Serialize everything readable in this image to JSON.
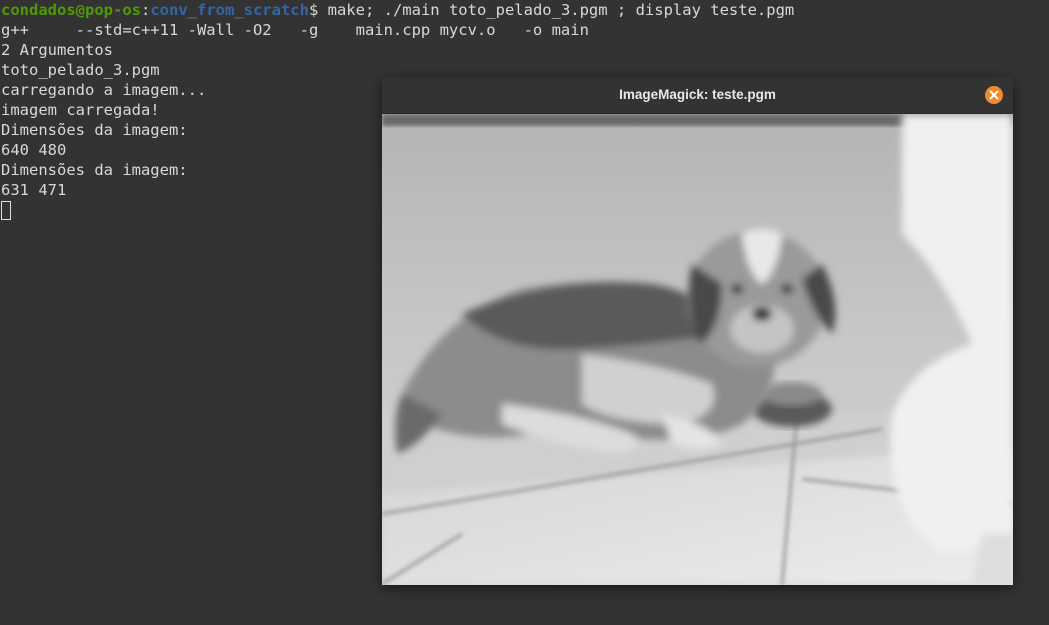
{
  "terminal": {
    "prompt_user_host": "condados@pop-os",
    "prompt_colon": ":",
    "prompt_path": "conv_from_scratch",
    "prompt_symbol": "$",
    "command": " make; ./main toto_pelado_3.pgm ; display teste.pgm",
    "output_lines": [
      "g++     --std=c++11 -Wall -O2   -g    main.cpp mycv.o   -o main",
      "2 Argumentos",
      "toto_pelado_3.pgm",
      "carregando a imagem...",
      "imagem carregada!",
      "Dimensões da imagem:",
      "640 480",
      "Dimensões da imagem:",
      "631 471"
    ]
  },
  "window": {
    "title": "ImageMagick: teste.pgm",
    "close_icon": "close-icon",
    "close_color": "#f0892e"
  },
  "image": {
    "description_icon": "dog-photo-grayscale"
  }
}
